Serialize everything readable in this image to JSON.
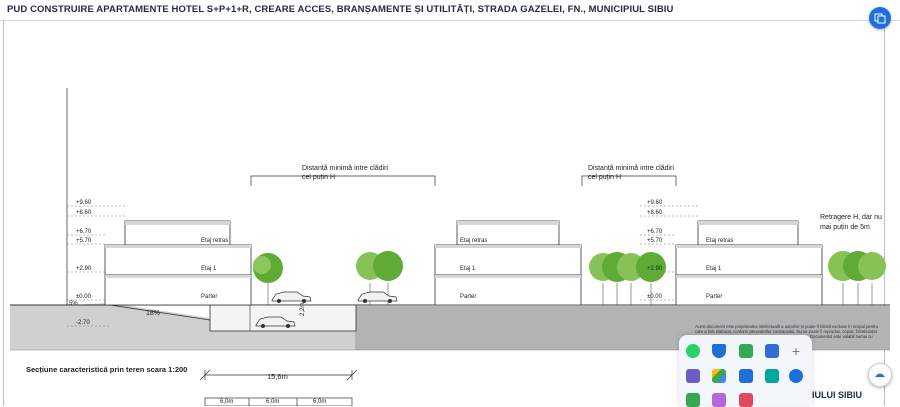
{
  "header": {
    "title": "PUD CONSTRUIRE APARTAMENTE HOTEL S+P+1+R, CREARE ACCES, BRANȘAMENTE ȘI UTILITĂȚI, STRADA GAZELEI, FN., MUNICIPIUL SIBIU"
  },
  "section": {
    "distance_note_line1": "Distanță minimă intre clădiri",
    "distance_note_line2": "cel puțin H",
    "setback_note_line1": "Retragere H, dar nu",
    "setback_note_line2": "mai puțin de 5m",
    "caption": "Secțiune caracteristică prin teren scara 1:200",
    "width_dimension": "15,6m",
    "bottom_dims": [
      "6,0m",
      "6,0m",
      "6,0m"
    ],
    "slope_label": "18%",
    "small_slope": "5%",
    "ramp_height": "2,2m",
    "levels": {
      "l960": "+9.60",
      "l860": "+8.60",
      "l670": "+6.70",
      "l570": "+5.70",
      "l290": "+2.90",
      "l000": "±0.00",
      "lm270": "-2.70"
    },
    "floors": {
      "retras": "Etaj retras",
      "etaj1": "Etaj 1",
      "parter": "Parter"
    },
    "footer_partial": "IULUI SIBIU"
  },
  "disclaimer": {
    "line1": "Acest document este proprietatea intelectuală a autorilor și poate fi folosit exclusiv în scopul pentru",
    "line2": "care a fost elaborat, conform prevederilor contractului. Nu se poate fi reprodus, copiat, întrebuințat",
    "line3": "Documentul este valabil numai cu"
  },
  "tray": {
    "icons": [
      "whatsapp-icon",
      "defender-icon",
      "meet-icon",
      "info-icon",
      "plus-icon",
      "teams-icon",
      "drive-icon",
      "chat-icon",
      "whiteboard-icon",
      "bluetooth-icon",
      "file-icon",
      "pen-icon",
      "snip-icon"
    ]
  },
  "colors": {
    "ground": "#b5b5b8",
    "building_fill": "#ffffff",
    "tree_green": "#6bb23e",
    "tree_light": "#9cd06a",
    "accent_blue": "#1e6fd9"
  }
}
